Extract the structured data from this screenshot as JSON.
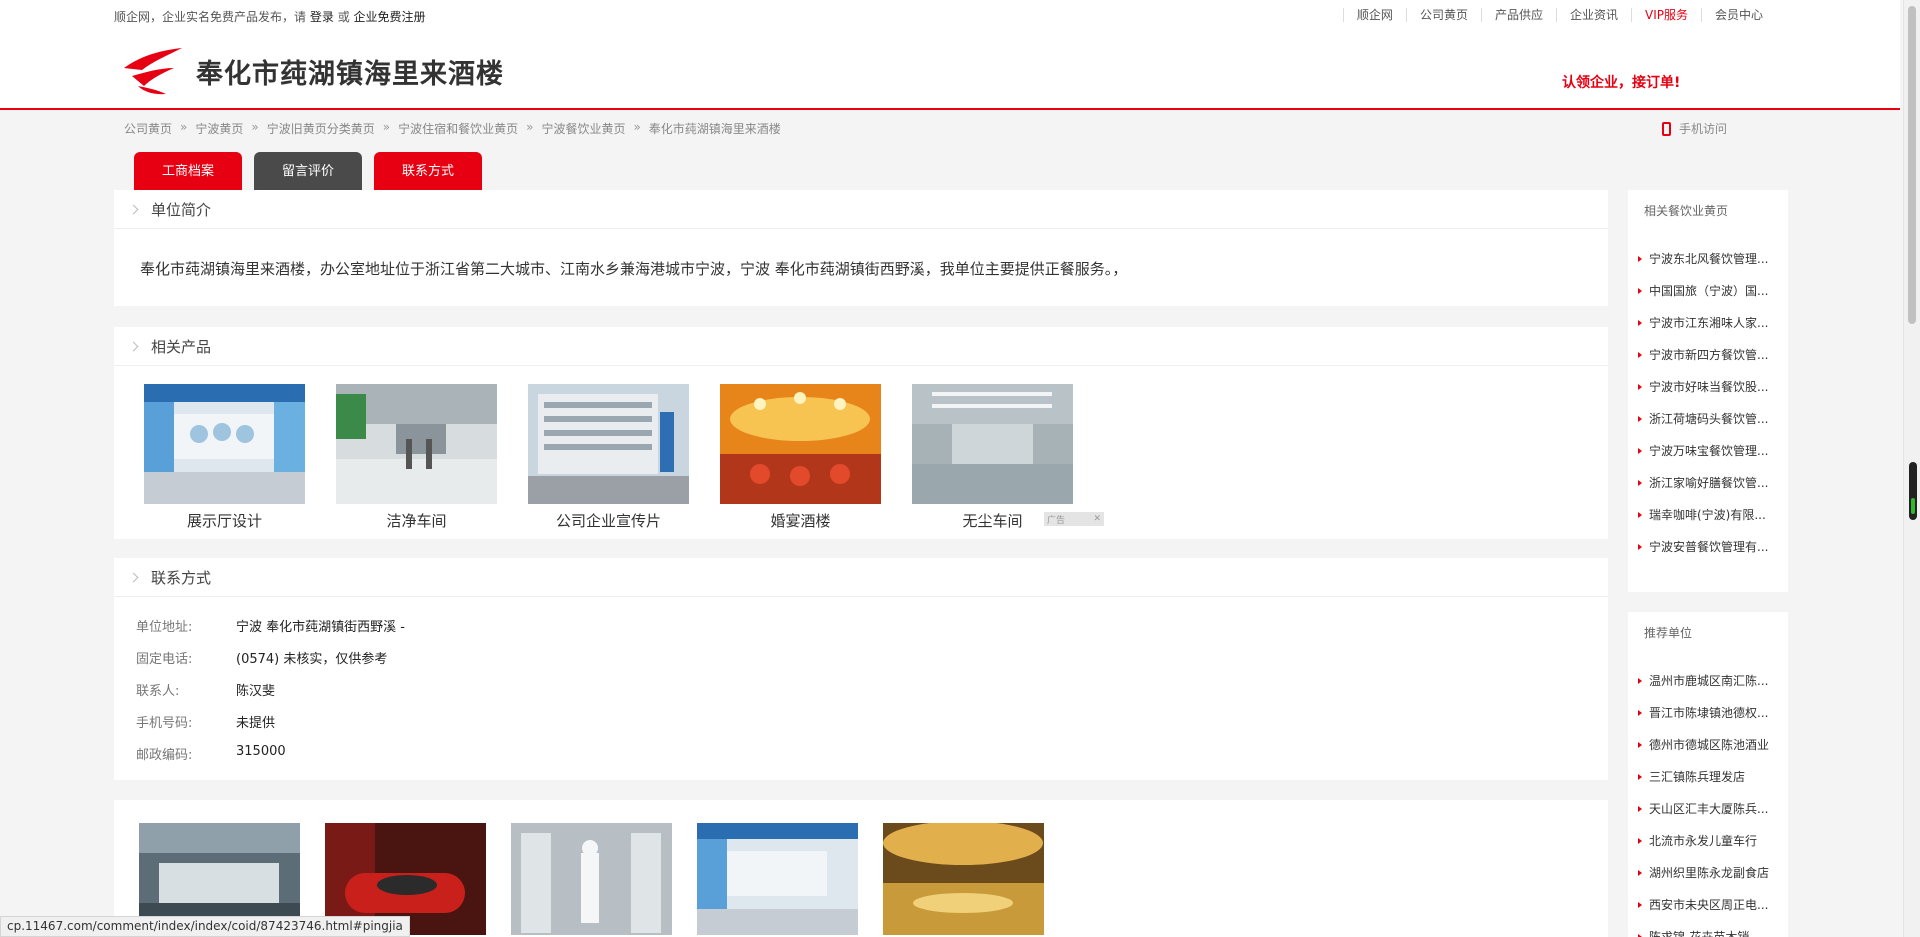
{
  "topbar": {
    "intro": "顺企网，企业实名免费产品发布，请",
    "login": "登录",
    "or": "或",
    "register": "企业免费注册",
    "nav": [
      "顺企网",
      "公司黄页",
      "产品供应",
      "企业资讯",
      "VIP服务",
      "会员中心"
    ]
  },
  "header": {
    "company_name": "奉化市莼湖镇海里来酒楼",
    "claim": "认领企业，接订单!"
  },
  "breadcrumb": [
    "公司黄页",
    "宁波黄页",
    "宁波旧黄页分类黄页",
    "宁波住宿和餐饮业黄页",
    "宁波餐饮业黄页",
    "奉化市莼湖镇海里来酒楼"
  ],
  "breadcrumb_sep": "»",
  "mobile_label": "手机访问",
  "tabs": [
    "工商档案",
    "留言评价",
    "联系方式"
  ],
  "intro": {
    "title": "单位简介",
    "text": "奉化市莼湖镇海里来酒楼，办公室地址位于浙江省第二大城市、江南水乡兼海港城市宁波，宁波 奉化市莼湖镇街西野溪，我单位主要提供正餐服务。，"
  },
  "products": {
    "title": "相关产品",
    "items": [
      {
        "caption": "展示厅设计"
      },
      {
        "caption": "洁净车间"
      },
      {
        "caption": "公司企业宣传片"
      },
      {
        "caption": "婚宴酒楼"
      },
      {
        "caption": "无尘车间"
      }
    ],
    "ad_label": "广告"
  },
  "contact": {
    "title": "联系方式",
    "rows": [
      {
        "label": "单位地址:",
        "value": "宁波 奉化市莼湖镇街西野溪 -"
      },
      {
        "label": "固定电话:",
        "value": "(0574) 未核实，仅供参考"
      },
      {
        "label": "联系人:",
        "value": "陈汉斐"
      },
      {
        "label": "手机号码:",
        "value": "未提供"
      },
      {
        "label": "邮政编码:",
        "value": "315000"
      }
    ]
  },
  "sidebar": {
    "related_title": "相关餐饮业黄页",
    "related": [
      "宁波东北风餐饮管理...",
      "中国国旅（宁波）国...",
      "宁波市江东湘味人家...",
      "宁波市新四方餐饮管...",
      "宁波市好味当餐饮股...",
      "浙江荷塘码头餐饮管...",
      "宁波万味宝餐饮管理...",
      "浙江家喻好膳餐饮管...",
      "瑞幸咖啡(宁波)有限...",
      "宁波安普餐饮管理有..."
    ],
    "recommend_title": "推荐单位",
    "recommend": [
      "温州市鹿城区南汇陈...",
      "晋江市陈埭镇池德权...",
      "德州市德城区陈池酒业",
      "三汇镇陈兵理发店",
      "天山区汇丰大厦陈兵...",
      "北流市永发儿童车行",
      "湖州织里陈永龙副食店",
      "西安市未央区周正电...",
      "陈求锦-花卉苗木销..."
    ]
  },
  "status_url": "cp.11467.com/comment/index/index/coid/87423746.html#pingjia",
  "colors": {
    "brand_red": "#e60012",
    "tab_dark": "#4a4a4a"
  }
}
